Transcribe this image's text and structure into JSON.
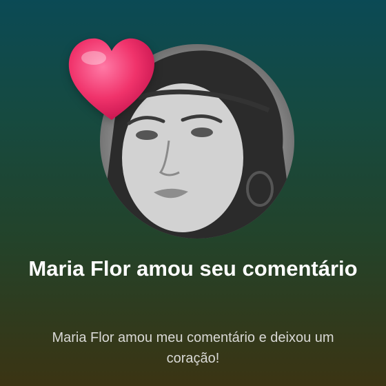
{
  "notification": {
    "title": "Maria Flor amou seu comentário",
    "message": "Maria Flor amou meu comentário e deixou um coração!"
  },
  "icons": {
    "heart": "heart-icon",
    "avatar": "profile-photo"
  },
  "colors": {
    "heart": "#f0336b",
    "title": "#ffffff",
    "message": "#d9d9d6"
  }
}
